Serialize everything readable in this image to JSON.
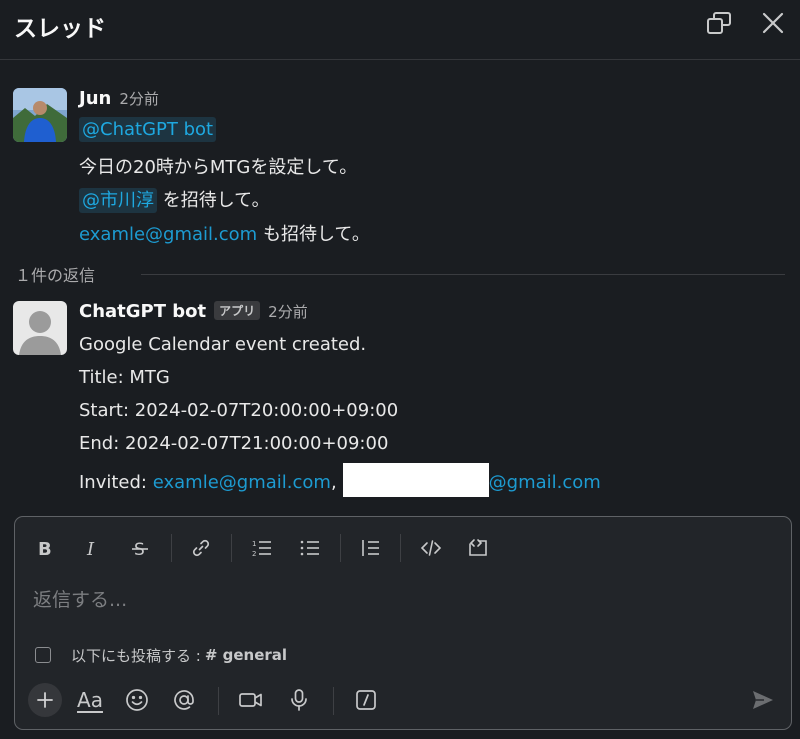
{
  "header": {
    "title": "スレッド"
  },
  "parent_message": {
    "author": "Jun",
    "time": "2分前",
    "mention_bot": "@ChatGPT bot",
    "line2": "今日の20時からMTGを設定して。",
    "mention_user": "@市川淳",
    "line3_suffix": " を招待して。",
    "email_link": "examle@gmail.com",
    "line4_suffix": " も招待して。"
  },
  "replies": {
    "count_label": "１件の返信"
  },
  "reply_message": {
    "author": "ChatGPT bot",
    "badge": "アプリ",
    "time": "2分前",
    "line1": "Google Calendar event created.",
    "line2": "Title: MTG",
    "line3": "Start: 2024-02-07T20:00:00+09:00",
    "line4": "End: 2024-02-07T21:00:00+09:00",
    "invited_label": "Invited: ",
    "invited_email1": "examle@gmail.com",
    "invited_sep": ",",
    "invited_email2_suffix": "@gmail.com"
  },
  "composer": {
    "placeholder": "返信する...",
    "also_send_label": "以下にも投稿する :",
    "channel": "# general",
    "format_button_label": "Aa"
  },
  "colors": {
    "background": "#1a1d21",
    "link": "#1d9bd1",
    "mention_bg": "#1d3441"
  },
  "icons": {
    "header": [
      "popout-icon",
      "close-icon"
    ],
    "format_toolbar": [
      "bold-icon",
      "italic-icon",
      "strikethrough-icon",
      "link-icon",
      "ordered-list-icon",
      "bulleted-list-icon",
      "blockquote-icon",
      "code-icon",
      "code-block-icon"
    ],
    "bottom_toolbar": [
      "plus-icon",
      "format-icon",
      "emoji-icon",
      "mention-icon",
      "video-icon",
      "microphone-icon",
      "slash-command-icon",
      "send-icon"
    ]
  }
}
